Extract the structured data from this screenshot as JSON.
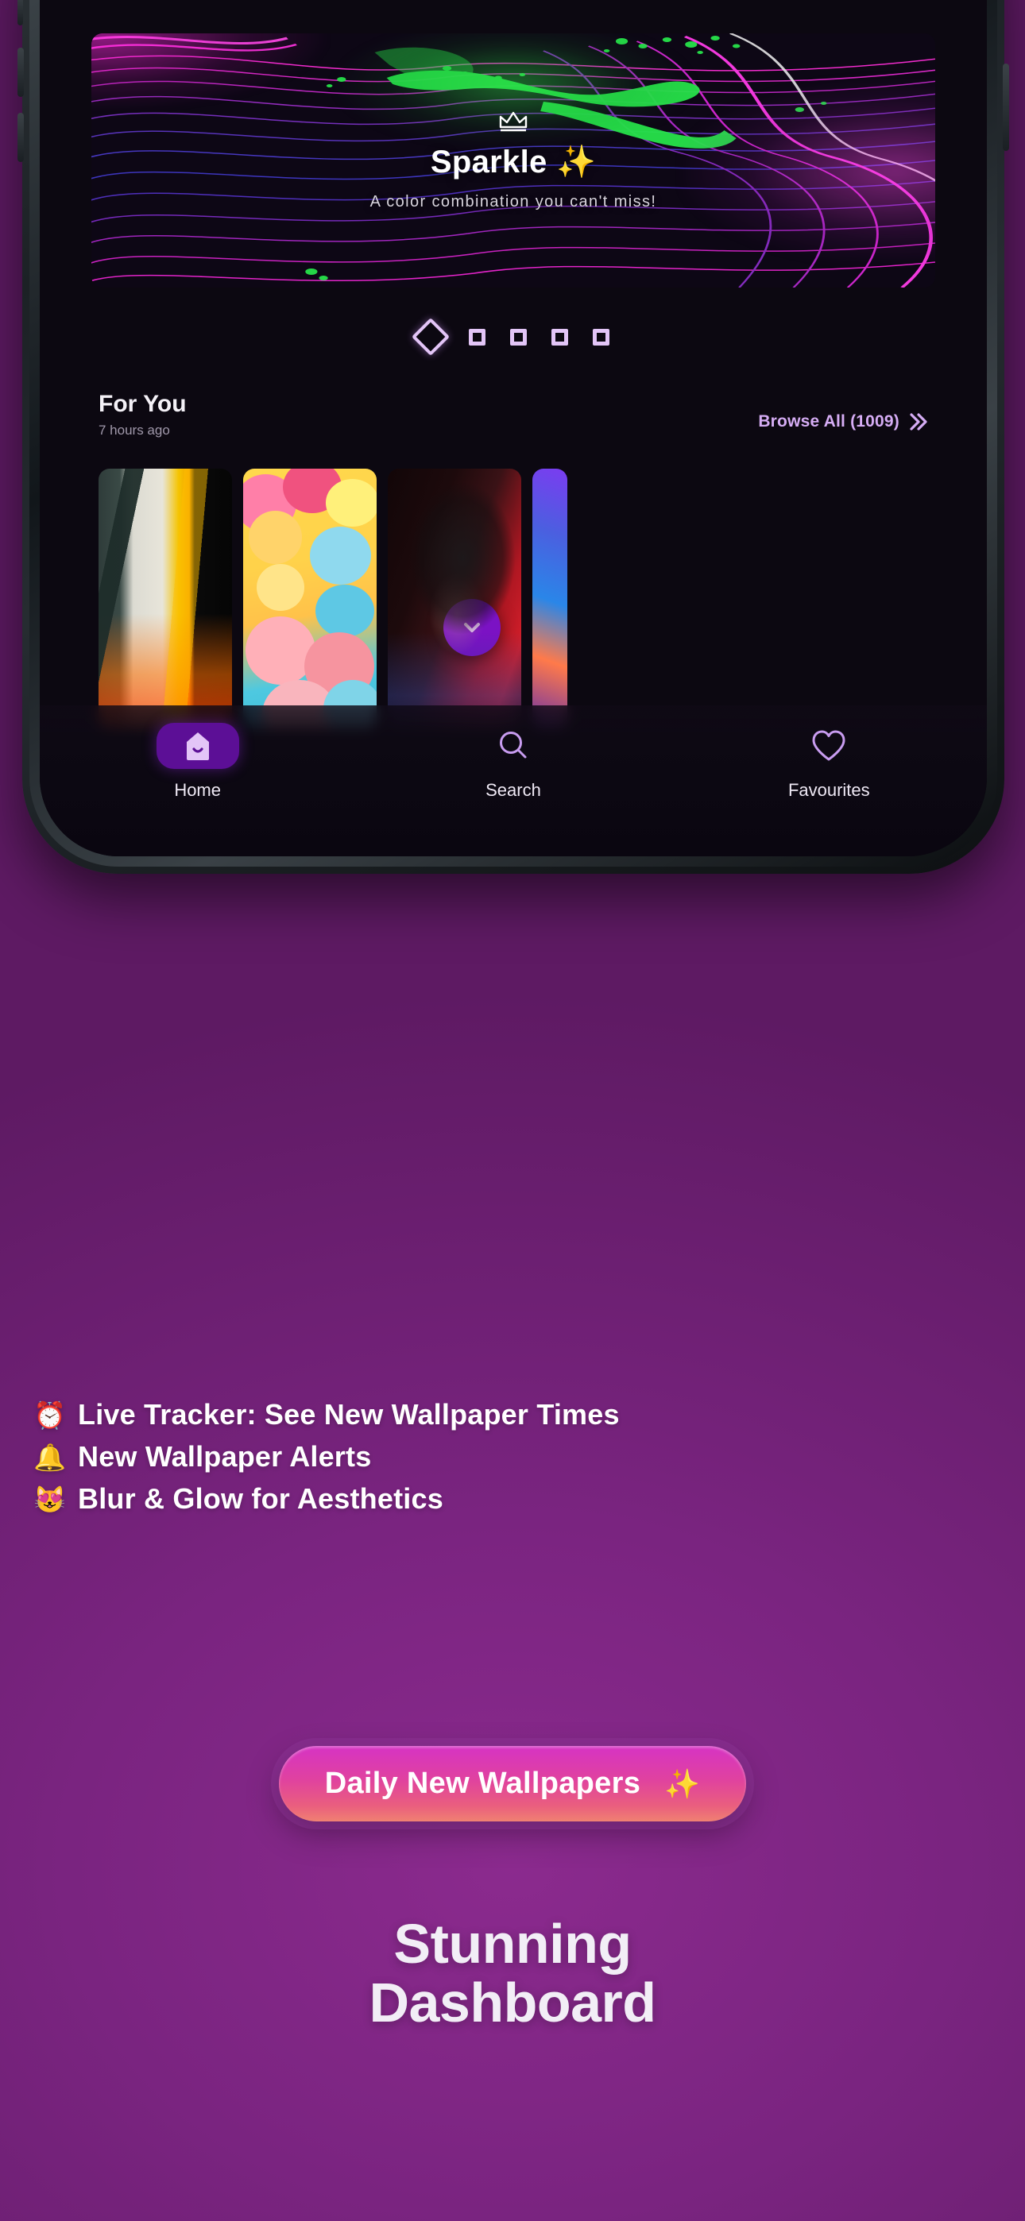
{
  "theme": {
    "page_bg": "#7d2380",
    "accent_purple": "#7b12c4",
    "accent_lavender": "#e3c5f7",
    "cta_top": "#d633c4",
    "cta_bottom": "#f08172",
    "text_white": "#ffffff"
  },
  "phone": {
    "hero": {
      "crown_icon": "crown-icon",
      "title": "Sparkle ✨",
      "subtitle": "A color combination you can't miss!"
    },
    "pagination": {
      "active_index": 0,
      "total": 5,
      "active_shape": "diamond-outline",
      "inactive_shape": "square-outline"
    },
    "for_you": {
      "title": "For You",
      "timestamp": "7 hours ago",
      "browse_label": "Browse All (1009)",
      "browse_icon": "double-chevron-right-icon",
      "count": 1009
    },
    "wallpapers": [
      {
        "name": "mountain-fjord-wallpaper"
      },
      {
        "name": "kawaii-pastel-wallpaper"
      },
      {
        "name": "dark-hero-portrait-wallpaper"
      },
      {
        "name": "blue-purple-landscape-wallpaper"
      }
    ],
    "scroll_fab": {
      "icon": "chevron-down-icon"
    },
    "nav": {
      "items": [
        {
          "label": "Home",
          "icon": "home-icon",
          "active": true
        },
        {
          "label": "Search",
          "icon": "search-icon",
          "active": false
        },
        {
          "label": "Favourites",
          "icon": "heart-icon",
          "active": false
        }
      ]
    }
  },
  "features": [
    {
      "emoji": "⏰",
      "icon": "alarm-clock-icon",
      "text": "Live Tracker: See New Wallpaper Times"
    },
    {
      "emoji": "🔔",
      "icon": "bell-icon",
      "text": "New Wallpaper Alerts"
    },
    {
      "emoji": "😻",
      "icon": "heart-eyes-cat-icon",
      "text": "Blur & Glow for Aesthetics"
    }
  ],
  "cta": {
    "label": "Daily New Wallpapers",
    "sparkle": "✨"
  },
  "headline": {
    "line1": "Stunning",
    "line2": "Dashboard"
  }
}
